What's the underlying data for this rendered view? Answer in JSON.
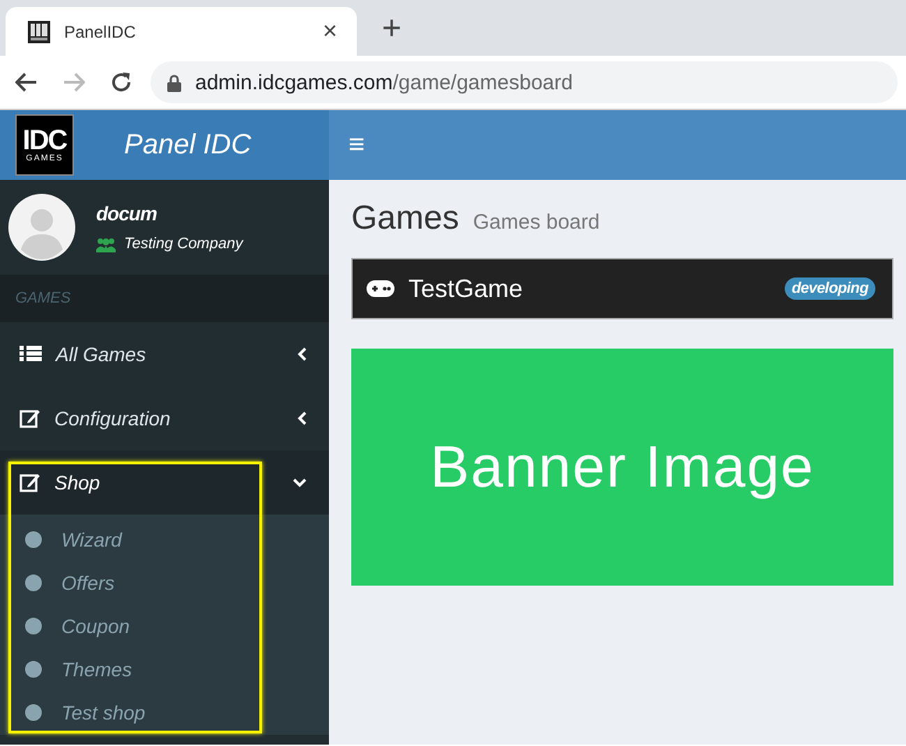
{
  "browser": {
    "tab_title": "PanelIDC",
    "close": "×",
    "new_tab": "+",
    "back_enabled": true,
    "forward_enabled": false,
    "url_host": "admin.idcgames.com",
    "url_path": "/game/gamesboard"
  },
  "header": {
    "logo_top": "IDC",
    "logo_bottom": "GAMES",
    "brand": "Panel IDC",
    "menu_toggle": "≡"
  },
  "user": {
    "name": "docum",
    "company": "Testing Company"
  },
  "sidebar": {
    "section": "GAMES",
    "items": [
      {
        "label": "All Games",
        "expanded": false,
        "highlighted": false
      },
      {
        "label": "Configuration",
        "expanded": false,
        "highlighted": false
      },
      {
        "label": "Shop",
        "expanded": true,
        "highlighted": true,
        "children": [
          {
            "label": "Wizard"
          },
          {
            "label": "Offers"
          },
          {
            "label": "Coupon"
          },
          {
            "label": "Themes"
          },
          {
            "label": "Test shop"
          }
        ]
      }
    ]
  },
  "page": {
    "title": "Games",
    "subtitle": "Games board"
  },
  "game": {
    "name": "TestGame",
    "status": "developing"
  },
  "banner": {
    "text": "Banner Image"
  }
}
